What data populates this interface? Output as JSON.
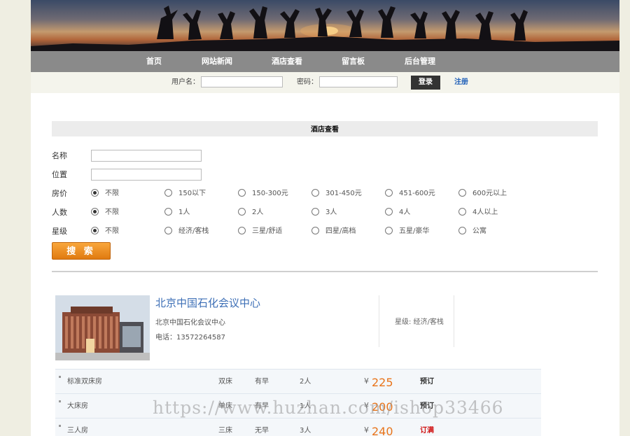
{
  "nav": [
    "首页",
    "网站新闻",
    "酒店查看",
    "留言板",
    "后台管理"
  ],
  "login": {
    "username_label": "用户名：",
    "password_label": "密码：",
    "login_button": "登录",
    "register_link": "注册"
  },
  "section_title": "酒店查看",
  "search": {
    "name_label": "名称",
    "location_label": "位置",
    "price": {
      "label": "房价",
      "options": [
        "不限",
        "150以下",
        "150-300元",
        "301-450元",
        "451-600元",
        "600元以上"
      ],
      "selected": "不限"
    },
    "people": {
      "label": "人数",
      "options": [
        "不限",
        "1人",
        "2人",
        "3人",
        "4人",
        "4人以上"
      ],
      "selected": "不限"
    },
    "star": {
      "label": "星级",
      "options": [
        "不限",
        "经济/客栈",
        "三星/舒适",
        "四星/高档",
        "五星/豪华",
        "公寓"
      ],
      "selected": "不限"
    },
    "search_button": "搜 索"
  },
  "hotel": {
    "name": "北京中国石化会议中心",
    "description": "北京中国石化会议中心",
    "phone": "电话：13572264587",
    "star": "星级: 经济/客栈"
  },
  "rooms": [
    {
      "name": "标准双床房",
      "bed": "双床",
      "breakfast": "有早",
      "capacity": "2人",
      "currency": "¥",
      "price": "225",
      "action": "预订",
      "full": false
    },
    {
      "name": "大床房",
      "bed": "单床",
      "breakfast": "有早",
      "capacity": "1人",
      "currency": "¥",
      "price": "200",
      "action": "预订",
      "full": false
    },
    {
      "name": "三人房",
      "bed": "三床",
      "breakfast": "无早",
      "capacity": "3人",
      "currency": "¥",
      "price": "240",
      "action": "订满",
      "full": true
    }
  ],
  "watermark": "https://www.huzhan.com/ishop33466",
  "colors": {
    "nav_bg": "#8a8a8a",
    "link_blue": "#3d6fb6",
    "price_orange": "#e8741a",
    "search_button": "#f08f1e",
    "full_red": "#d01010"
  }
}
